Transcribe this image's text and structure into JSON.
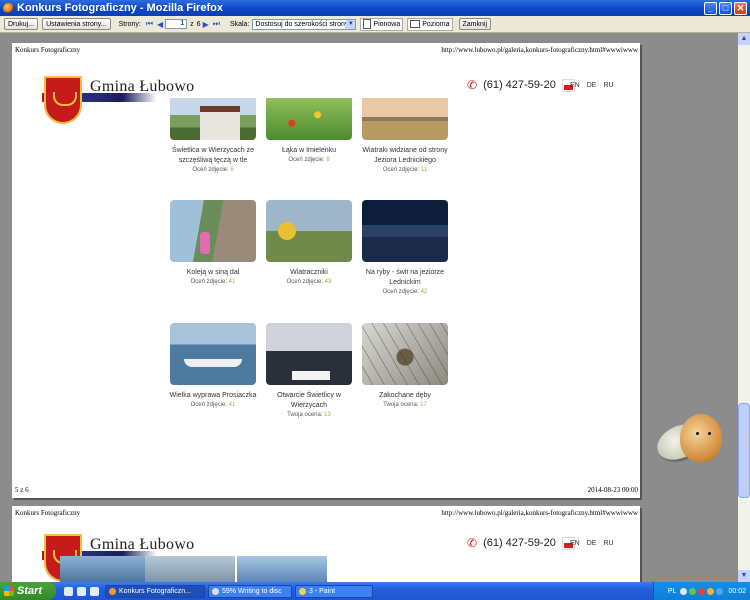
{
  "window": {
    "title": "Konkurs Fotograficzny - Mozilla Firefox"
  },
  "toolbar": {
    "print_label": "Drukuj...",
    "page_setup_label": "Ustawienia strony...",
    "pages_label": "Strony:",
    "current_page": "1",
    "of_label": "z",
    "total_pages": "6",
    "scale_label": "Skala:",
    "scale_value": "Dostosuj do szerokości strony",
    "portrait_label": "Pionowa",
    "landscape_label": "Pozioma",
    "close_label": "Zamknij"
  },
  "page1": {
    "header_left": "Konkurs Fotograficzny",
    "header_right": "http://www.lubowo.pl/galeria,konkurs-fotograficzny.html#wwwiwww",
    "footer_left": "5 z 6",
    "footer_right": "2014-08-23 00:00",
    "logo_text": "Gmina Łubowo",
    "phone": "(61) 427-59-20",
    "languages": [
      "EN",
      "DE",
      "RU"
    ],
    "items": [
      {
        "caption": "Świetlica w Wierzycach ze szczęśliwą tęczą w tle",
        "score_label": "Oceń zdjęcie:",
        "score": "6"
      },
      {
        "caption": "Łąka w Imielenku",
        "score_label": "Oceń zdjęcie:",
        "score": "8"
      },
      {
        "caption": "Wiatraki widziane od strony Jeziora Lednickiego",
        "score_label": "Oceń zdjęcie:",
        "score": "11"
      },
      {
        "caption": "Koleją w siną dal",
        "score_label": "Oceń zdjęcie:",
        "score": "41"
      },
      {
        "caption": "Wiatraczniki",
        "score_label": "Oceń zdjęcie:",
        "score": "43"
      },
      {
        "caption": "Na ryby - świt na jeziorze Lednickim",
        "score_label": "Oceń zdjęcie:",
        "score": "42"
      },
      {
        "caption": "Wielka wyprawa Prosiaczka",
        "score_label": "Oceń zdjęcie:",
        "score": "41"
      },
      {
        "caption": "Otwarcie Świetlicy w Wierzycach",
        "score_label": "Twoja ocena:",
        "score": "13"
      },
      {
        "caption": "Zakochane dęby",
        "score_label": "Twoja ocena:",
        "score": "17"
      }
    ]
  },
  "page2": {
    "header_left": "Konkurs Fotograficzny",
    "header_right": "http://www.lubowo.pl/galeria,konkurs-fotograficzny.html#wwwiwww",
    "logo_text": "Gmina Łubowo",
    "phone": "(61) 427-59-20",
    "languages": [
      "EN",
      "DE",
      "RU"
    ]
  },
  "taskbar": {
    "start_label": "Start",
    "tasks": [
      {
        "label": "Konkurs Fotograficzn..."
      },
      {
        "label": "59% Writing to disc"
      },
      {
        "label": "3 - Paint"
      }
    ],
    "tray_lang": "PL",
    "clock": "00:02"
  }
}
